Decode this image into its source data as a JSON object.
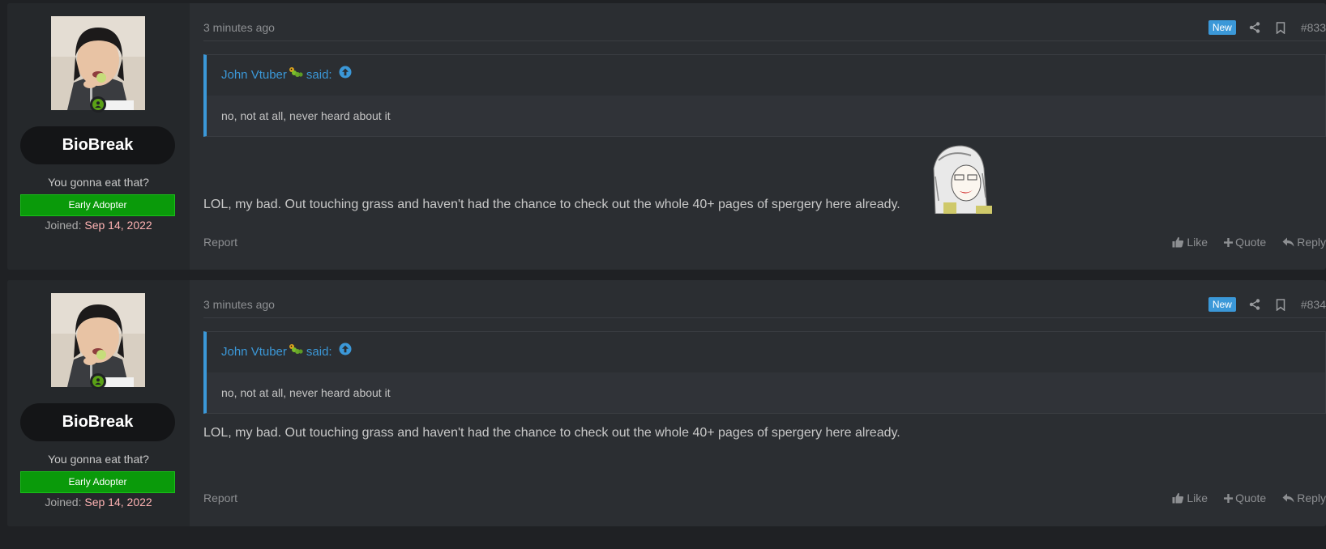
{
  "posts": [
    {
      "time": "3 minutes ago",
      "badge": "New",
      "post_number": "#833",
      "user": {
        "name": "BioBreak",
        "title": "You gonna eat that?",
        "banner": "Early Adopter",
        "joined_label": "Joined:",
        "joined_date": "Sep 14, 2022"
      },
      "quote": {
        "author": "John Vtuber",
        "said": "said:",
        "text": "no, not at all, never heard about it"
      },
      "message": "LOL, my bad. Out touching grass and haven't had the chance to check out the whole 40+ pages of spergery here already.",
      "has_sticker": true,
      "footer": {
        "report": "Report",
        "like": "Like",
        "quote": "Quote",
        "reply": "Reply"
      }
    },
    {
      "time": "3 minutes ago",
      "badge": "New",
      "post_number": "#834",
      "user": {
        "name": "BioBreak",
        "title": "You gonna eat that?",
        "banner": "Early Adopter",
        "joined_label": "Joined:",
        "joined_date": "Sep 14, 2022"
      },
      "quote": {
        "author": "John Vtuber",
        "said": "said:",
        "text": "no, not at all, never heard about it"
      },
      "message": "LOL, my bad. Out touching grass and haven't had the chance to check out the whole 40+ pages of spergery here already.",
      "has_sticker": false,
      "footer": {
        "report": "Report",
        "like": "Like",
        "quote": "Quote",
        "reply": "Reply"
      }
    }
  ],
  "colors": {
    "accent": "#3b98d8",
    "banner_green": "#0a9a0a",
    "joined_date": "#ffb3b3",
    "online": "#5aa016"
  }
}
